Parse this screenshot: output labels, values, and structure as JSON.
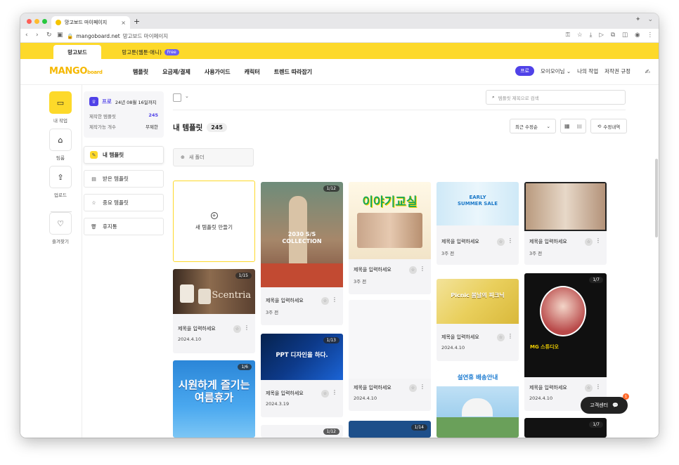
{
  "browser": {
    "tab_title": "망고보드 마이페이지",
    "tab_close": "×",
    "new_tab": "+",
    "url_domain": "mangoboard.net",
    "url_title": "망고보드 마이페이지"
  },
  "service_tabs": {
    "active": "망고보드",
    "other": "망고툰(웹툰·애니)",
    "free_badge": "Free"
  },
  "header": {
    "logo": "MANGO",
    "logo_sub": "board",
    "nav": [
      "템플릿",
      "요금제/결제",
      "사용가이드",
      "캐릭터",
      "트렌드 따라잡기"
    ],
    "plan_badge": "프로",
    "user_name": "모이모이님",
    "my_work": "나의 작업",
    "copyright": "저작권 규정"
  },
  "rail": {
    "items": [
      {
        "label": "내 작업",
        "icon": "folder-icon",
        "glyph": "▭"
      },
      {
        "label": "팀룸",
        "icon": "team-icon",
        "glyph": "⌂"
      },
      {
        "label": "업로드",
        "icon": "upload-icon",
        "glyph": "⇪"
      },
      {
        "label": "즐겨찾기",
        "icon": "heart-icon",
        "glyph": "♡"
      }
    ]
  },
  "plan_card": {
    "plan": "프로",
    "expiry": "24년 08월 16일까지",
    "made_label": "제작한 템플릿",
    "made_value": "245",
    "avail_label": "제작가능 개수",
    "avail_value": "무제한"
  },
  "side_menu": [
    {
      "label": "내 템플릿",
      "glyph": "✎"
    },
    {
      "label": "받은 템플릿",
      "glyph": "▤"
    },
    {
      "label": "중요 템플릿",
      "glyph": "☆"
    },
    {
      "label": "휴지통",
      "glyph": "🗑"
    }
  ],
  "toolbar": {
    "search_placeholder": "템플릿 제목으로 검색",
    "section_title": "내 템플릿",
    "count": "245",
    "sort": "최근 수정순",
    "edit_history": "수정내역",
    "new_folder": "새 폴더",
    "new_template": "새 템플릿 만들기"
  },
  "cards": [
    {
      "name": "제목을 입력하세요",
      "date": "2024.4.10",
      "page": "1/15",
      "thumb": "Scentria"
    },
    {
      "name": "",
      "date": "",
      "page": "1/6",
      "thumb": "시원하게 즐기는 여름휴가"
    },
    {
      "name": "제목을 입력하세요",
      "date": "3주 전",
      "page": "1/12",
      "thumb": "2030 S/S COLLECTION"
    },
    {
      "name": "제목을 입력하세요",
      "date": "2024.3.19",
      "page": "1/13",
      "thumb": "PPT 디자인을 하다."
    },
    {
      "name": "",
      "date": "",
      "page": "1/12",
      "thumb": ""
    },
    {
      "name": "제목을 입력하세요",
      "date": "3주 전",
      "page": "",
      "thumb": "이야기교실"
    },
    {
      "name": "제목을 입력하세요",
      "date": "2024.4.10",
      "page": "",
      "thumb": ""
    },
    {
      "name": "",
      "date": "",
      "page": "1/14",
      "thumb": ""
    },
    {
      "name": "제목을 입력하세요",
      "date": "3주 전",
      "page": "",
      "thumb": "EARLY SUMMER SALE"
    },
    {
      "name": "제목을 입력하세요",
      "date": "2024.4.10",
      "page": "",
      "thumb": "Picnic 봄날의 피크닉"
    },
    {
      "name": "",
      "date": "",
      "page": "",
      "thumb": "설연휴 배송안내"
    },
    {
      "name": "제목을 입력하세요",
      "date": "3주 전",
      "page": "",
      "thumb": ""
    },
    {
      "name": "제목을 입력하세요",
      "date": "2024.4.10",
      "page": "1/7",
      "thumb": "MG 스튜디오"
    },
    {
      "name": "",
      "date": "",
      "page": "1/7",
      "thumb": ""
    }
  ],
  "cs_button": "고객센터",
  "cs_badge": "1",
  "colors": {
    "brand_yellow": "#fdd92a",
    "pro_purple": "#5042e8"
  }
}
